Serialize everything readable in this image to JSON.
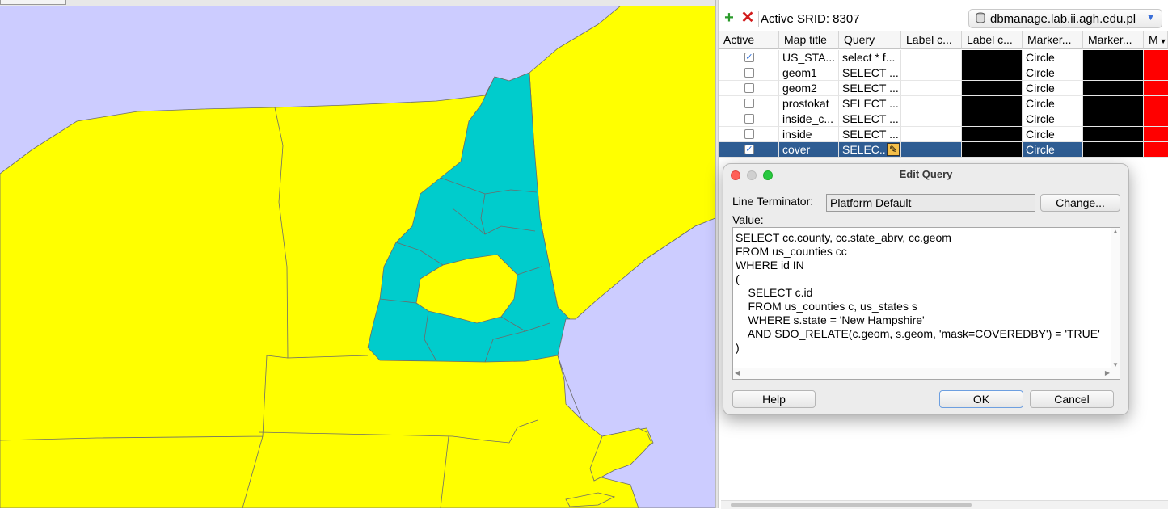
{
  "toolbar": {
    "active_srid": "Active SRID: 8307",
    "connection": "dbmanage.lab.ii.agh.edu.pl",
    "add_icon": "plus-icon",
    "remove_icon": "cross-icon"
  },
  "table": {
    "headers": [
      "Active",
      "Map title",
      "Query",
      "Label c...",
      "Label c...",
      "Marker...",
      "Marker...",
      "M"
    ],
    "rows": [
      {
        "active": true,
        "title": "US_STA...",
        "query": "select * f...",
        "marker": "Circle"
      },
      {
        "active": false,
        "title": "geom1",
        "query": "SELECT ...",
        "marker": "Circle"
      },
      {
        "active": false,
        "title": "geom2",
        "query": "SELECT ...",
        "marker": "Circle"
      },
      {
        "active": false,
        "title": "prostokat",
        "query": "SELECT  ...",
        "marker": "Circle"
      },
      {
        "active": false,
        "title": "inside_c...",
        "query": "SELECT ...",
        "marker": "Circle"
      },
      {
        "active": false,
        "title": "inside",
        "query": "SELECT ...",
        "marker": "Circle"
      },
      {
        "active": true,
        "title": "cover",
        "query": "SELEC...",
        "marker": "Circle",
        "selected": true
      }
    ],
    "colors": {
      "label_color": "#000000",
      "marker_color": "#000000",
      "last_color": "#ff0000",
      "selected_row": "#2f5d93"
    }
  },
  "dialog": {
    "title": "Edit Query",
    "line_terminator_label": "Line Terminator:",
    "line_terminator_value": "Platform Default",
    "change_button": "Change...",
    "value_label": "Value:",
    "query_text": "SELECT cc.county, cc.state_abrv, cc.geom\nFROM us_counties cc\nWHERE id IN\n(\n    SELECT c.id\n    FROM us_counties c, us_states s\n    WHERE s.state = 'New Hampshire'\n    AND SDO_RELATE(c.geom, s.geom, 'mask=COVEREDBY') = 'TRUE'\n)",
    "help_button": "Help",
    "ok_button": "OK",
    "cancel_button": "Cancel"
  },
  "map": {
    "colors": {
      "water": "#ccccff",
      "land": "#ffff00",
      "highlight": "#00cccc",
      "border": "#6b6b6b"
    }
  }
}
